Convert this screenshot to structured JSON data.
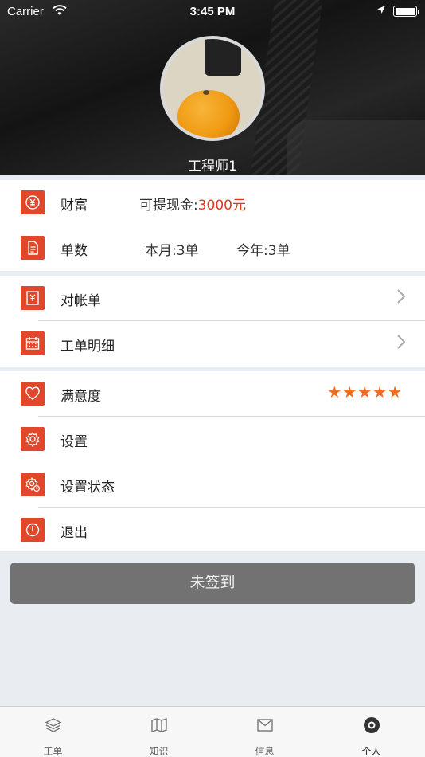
{
  "status_bar": {
    "carrier": "Carrier",
    "time": "3:45 PM"
  },
  "profile": {
    "name": "工程师1"
  },
  "wealth": {
    "label": "财富",
    "withdrawable_label": "可提现金:",
    "withdrawable_value": "3000元"
  },
  "orders": {
    "label": "单数",
    "this_month": "本月:3单",
    "this_year": "今年:3单"
  },
  "menu1": [
    {
      "label": "对帐单"
    },
    {
      "label": "工单明细"
    }
  ],
  "menu2": {
    "satisfaction": {
      "label": "满意度",
      "stars": 5,
      "stars_text": "★★★★★"
    },
    "settings": {
      "label": "设置"
    },
    "status_settings": {
      "label": "设置状态"
    },
    "logout": {
      "label": "退出"
    }
  },
  "signin_button": {
    "label": "未签到"
  },
  "tabs": [
    {
      "label": "工单",
      "icon": "layers-icon"
    },
    {
      "label": "知识",
      "icon": "map-icon"
    },
    {
      "label": "信息",
      "icon": "mail-icon"
    },
    {
      "label": "个人",
      "icon": "person-icon",
      "active": true
    }
  ],
  "colors": {
    "accent": "#e0472b",
    "money": "#e8341c",
    "stars": "#f36a1d",
    "button": "#727272"
  }
}
